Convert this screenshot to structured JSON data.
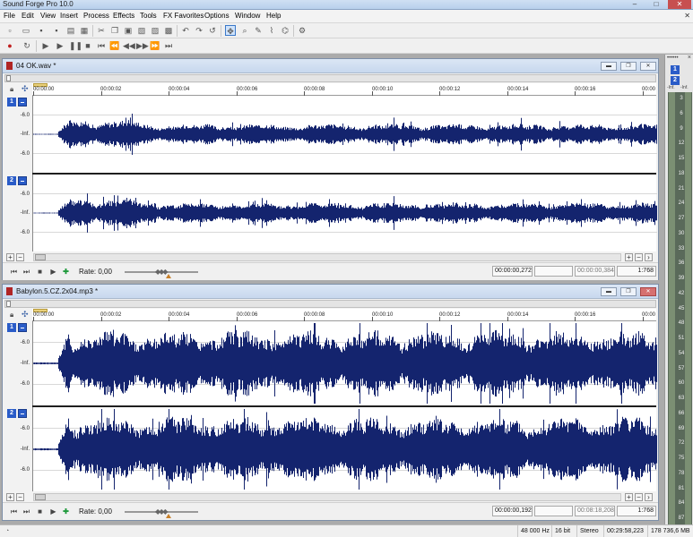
{
  "app": {
    "title": "Sound Forge Pro 10.0"
  },
  "menu": [
    "File",
    "Edit",
    "View",
    "Insert",
    "Process",
    "Effects",
    "Tools",
    "FX Favorites",
    "Options",
    "Window",
    "Help"
  ],
  "windows": [
    {
      "title": "04 OK.wav *",
      "ticks": [
        "00:00:00",
        "00:00:02",
        "00:00:04",
        "00:00:06",
        "00:00:08",
        "00:00:10",
        "00:00:12",
        "00:00:14",
        "00:00:16",
        "00:00"
      ],
      "channels": [
        {
          "number": "1",
          "db_labels": [
            "-6.0",
            "-Inf.",
            "-6.0"
          ]
        },
        {
          "number": "2",
          "db_labels": [
            "-6.0",
            "-Inf.",
            "-6.0"
          ]
        }
      ],
      "rate_label": "Rate: 0,00",
      "selection_start": "00:00:00,272",
      "selection_length": "00:00:00,384",
      "zoom": "1:768",
      "waveform_amplitude": 0.42
    },
    {
      "title": "Babylon.5.CZ.2x04.mp3 *",
      "ticks": [
        "00:00:00",
        "00:00:02",
        "00:00:04",
        "00:00:06",
        "00:00:08",
        "00:00:10",
        "00:00:12",
        "00:00:14",
        "00:00:16",
        "00:00"
      ],
      "channels": [
        {
          "number": "1",
          "db_labels": [
            "-6.0",
            "-Inf.",
            "-6.0"
          ]
        },
        {
          "number": "2",
          "db_labels": [
            "-6.0",
            "-Inf.",
            "-6.0"
          ]
        }
      ],
      "rate_label": "Rate: 0,00",
      "selection_start": "00:00:00,192",
      "selection_length": "00:08:18,208",
      "zoom": "1:768",
      "waveform_amplitude": 0.85
    }
  ],
  "meters": {
    "header": "••••••",
    "close": "×",
    "channels": [
      "1",
      "2"
    ],
    "inf_labels": [
      "-Inf.",
      "-Inf."
    ],
    "scale": [
      "3",
      "6",
      "9",
      "12",
      "15",
      "18",
      "21",
      "24",
      "27",
      "30",
      "33",
      "36",
      "39",
      "42",
      "45",
      "48",
      "51",
      "54",
      "57",
      "60",
      "63",
      "66",
      "69",
      "72",
      "75",
      "78",
      "81",
      "84",
      "87"
    ]
  },
  "status": {
    "sample_rate": "48 000 Hz",
    "bit_depth": "16 bit",
    "channels": "Stereo",
    "length": "00:29:58,223",
    "disk_space": "178 736,6 MB"
  },
  "colors": {
    "waveform": "#14246e",
    "channel_badge": "#2a5cc8"
  }
}
